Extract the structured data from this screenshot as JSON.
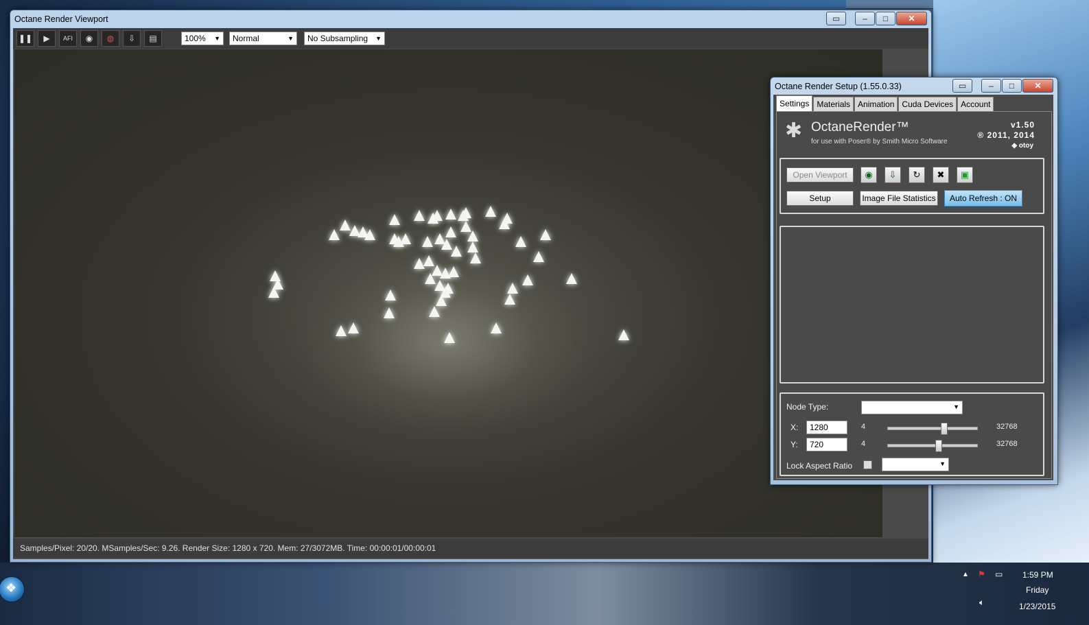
{
  "viewport": {
    "title": "Octane Render Viewport",
    "toolbar": {
      "icons": [
        "pause-icon",
        "play-icon",
        "afi-icon",
        "camera-icon",
        "color-icon",
        "export-icon",
        "calculator-icon"
      ],
      "afi_text": "AFI",
      "zoom": "100%",
      "mode": "Normal",
      "subsampling": "No Subsampling"
    },
    "status": "Samples/Pixel: 20/20. MSamples/Sec: 9.26. Render Size: 1280 x 720. Mem: 27/3072MB. Time: 00:00:01/00:00:01"
  },
  "setup": {
    "title": "Octane Render Setup (1.55.0.33)",
    "tabs": [
      "Settings",
      "Materials",
      "Animation",
      "Cuda Devices",
      "Account"
    ],
    "brand": {
      "name": "OctaneRender™",
      "tagline": "for use with Poser® by Smith Micro Software",
      "version": "v1.50",
      "copyright": "® 2011, 2014",
      "otoy": "otoy"
    },
    "buttons": {
      "open_viewport": "Open Viewport",
      "setup": "Setup",
      "image_stats": "Image File Statistics",
      "auto_refresh": "Auto Refresh : ON"
    },
    "node": {
      "node_type_label": "Node Type:",
      "node_type_value": "",
      "x_label": "X:",
      "x_value": "1280",
      "x_min": "4",
      "x_max": "32768",
      "x_level": 0.63,
      "y_label": "Y:",
      "y_value": "720",
      "y_min": "4",
      "y_max": "32768",
      "y_level": 0.57,
      "lock_label": "Lock Aspect Ratio",
      "lock_checked": false
    }
  },
  "taskbar": {
    "time": "1:59 PM",
    "day": "Friday",
    "date": "1/23/2015"
  }
}
